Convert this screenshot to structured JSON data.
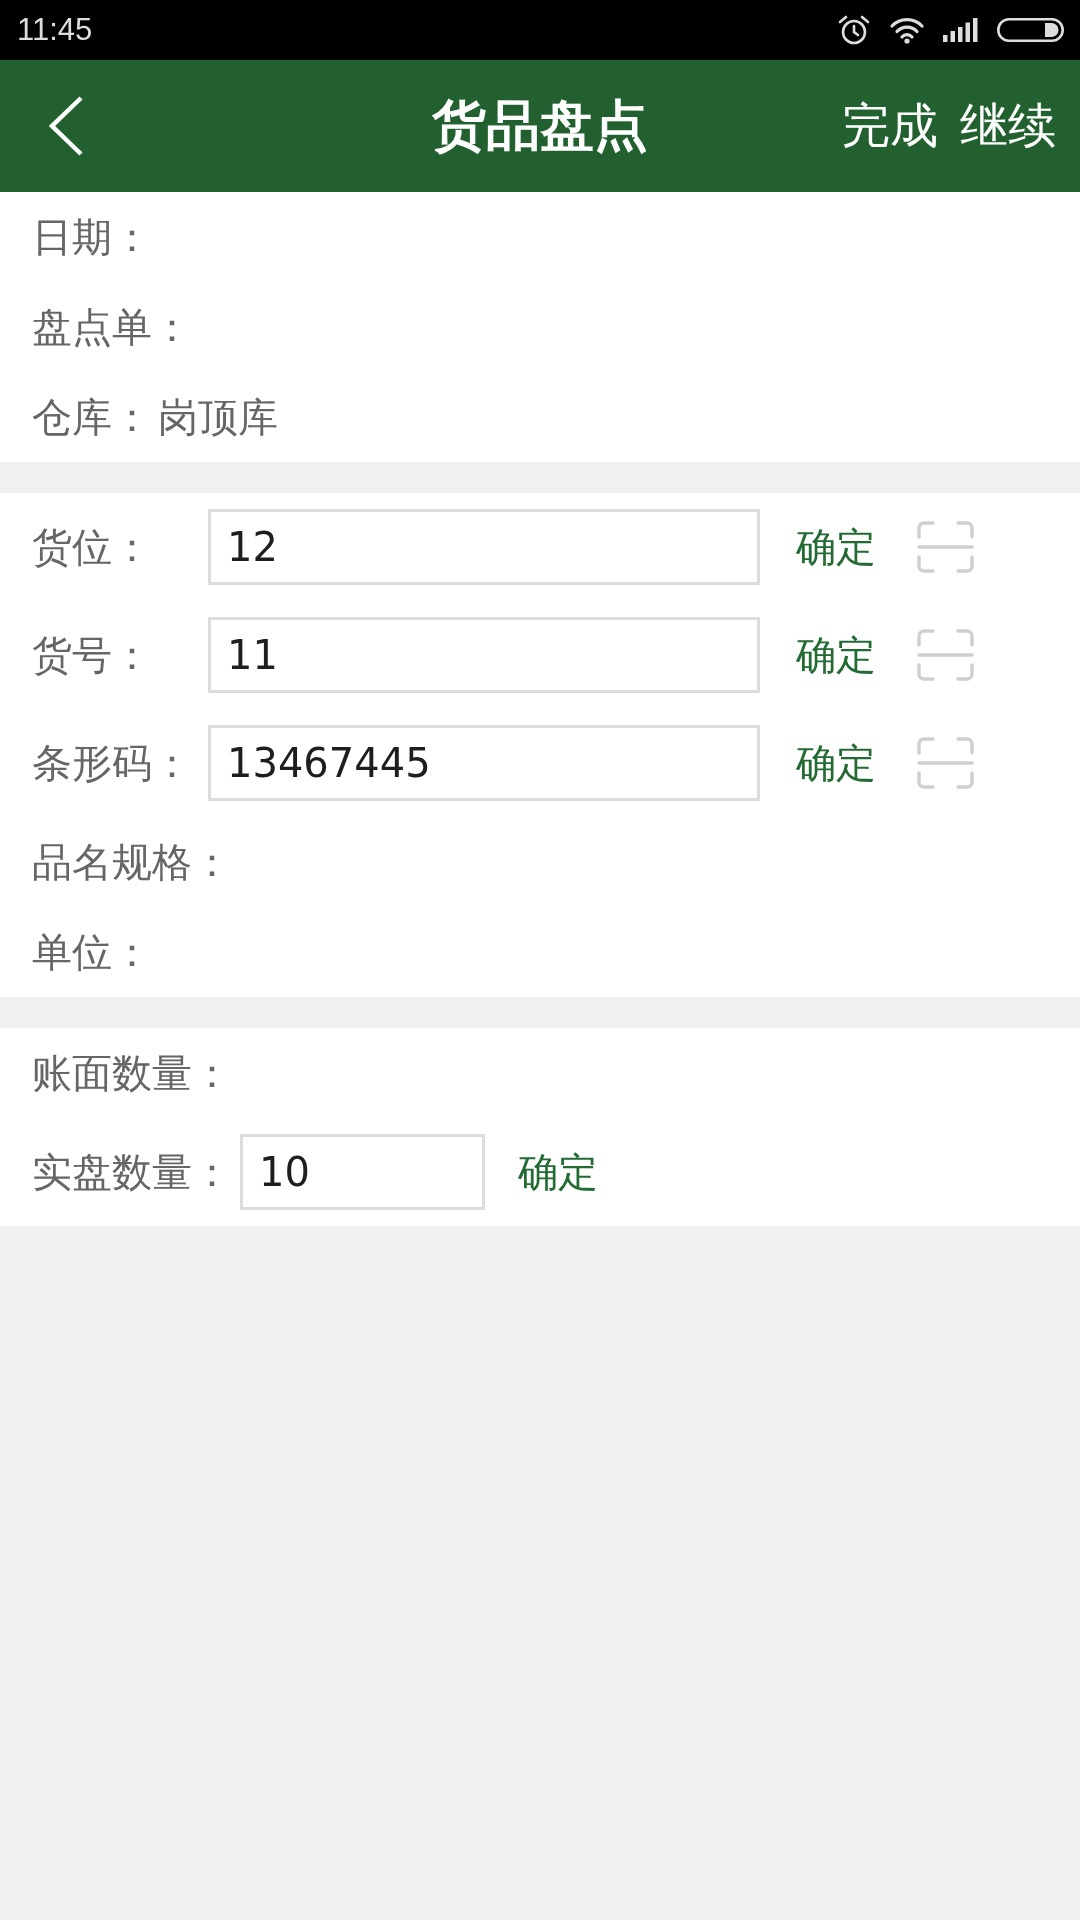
{
  "status_bar": {
    "time": "11:45"
  },
  "header": {
    "title": "货品盘点",
    "actions": [
      "完成",
      "继续"
    ]
  },
  "sections": [
    {
      "rows": [
        {
          "kind": "text",
          "label": "日期："
        },
        {
          "kind": "text",
          "label": "盘点单："
        },
        {
          "kind": "text",
          "label": "仓库：",
          "value": "岗顶库"
        }
      ]
    },
    {
      "rows": [
        {
          "kind": "scan_input",
          "label": "货位：",
          "value": "12",
          "button": "确定"
        },
        {
          "kind": "scan_input",
          "label": "货号：",
          "value": "11",
          "button": "确定"
        },
        {
          "kind": "scan_input",
          "label": "条形码：",
          "value": "13467445",
          "button": "确定"
        },
        {
          "kind": "text",
          "label": "品名规格："
        },
        {
          "kind": "text",
          "label": "单位："
        }
      ]
    },
    {
      "rows": [
        {
          "kind": "text",
          "label": "账面数量："
        },
        {
          "kind": "input",
          "label": "实盘数量：",
          "value": "10",
          "button": "确定"
        }
      ]
    }
  ]
}
